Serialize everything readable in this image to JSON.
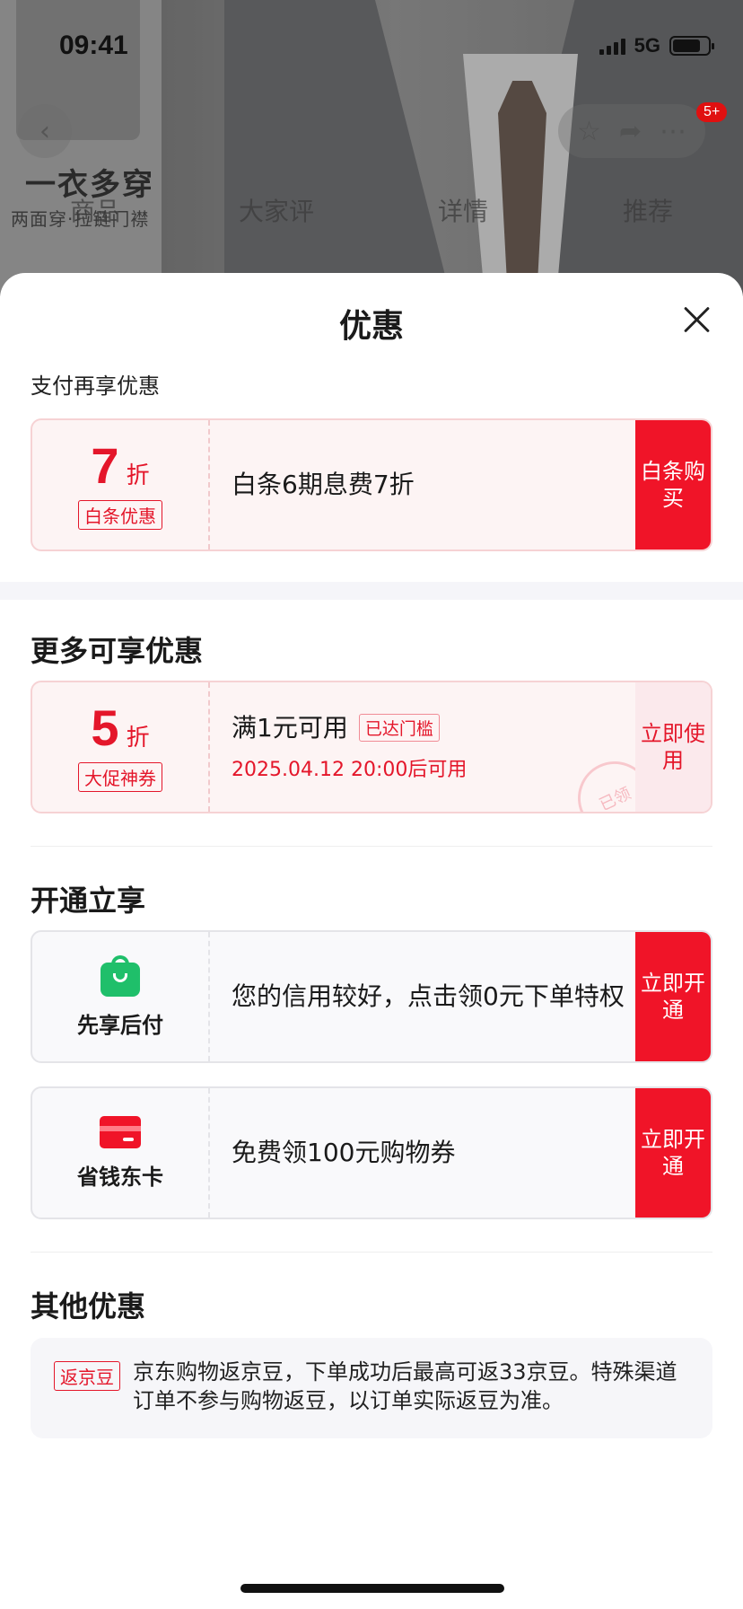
{
  "status_bar": {
    "time": "09:41",
    "network": "5G"
  },
  "background": {
    "promo_title": "一衣多穿",
    "promo_subtitle": "两面穿·拉链门襟",
    "badge": "5+",
    "tabs": [
      "商品",
      "大家评",
      "详情",
      "推荐"
    ]
  },
  "sheet": {
    "title": "优惠",
    "pay_section": {
      "label": "支付再享优惠",
      "card": {
        "discount": "7",
        "unit": "折",
        "tag": "白条优惠",
        "text": "白条6期息费7折",
        "cta": "白条购买"
      }
    },
    "more_section": {
      "heading": "更多可享优惠",
      "card": {
        "discount": "5",
        "unit": "折",
        "tag": "大促神券",
        "text": "满1元可用",
        "status_tag": "已达门槛",
        "date": "2025.04.12 20:00后可用",
        "stamp": "已领",
        "cta": "立即使用"
      }
    },
    "open_section": {
      "heading": "开通立享",
      "cards": [
        {
          "icon": "shopping-bag-icon",
          "label": "先享后付",
          "text": "您的信用较好，点击领0元下单特权",
          "cta": "立即开通"
        },
        {
          "icon": "credit-card-icon",
          "label": "省钱东卡",
          "text": "免费领100元购物券",
          "cta": "立即开通"
        }
      ]
    },
    "other_section": {
      "heading": "其他优惠",
      "tag": "返京豆",
      "text": "京东购物返京豆，下单成功后最高可返33京豆。特殊渠道订单不参与购物返豆，以订单实际返豆为准。"
    }
  },
  "colors": {
    "accent": "#f01428",
    "accent_light": "#fbe9ec",
    "success": "#1fbf6a"
  }
}
